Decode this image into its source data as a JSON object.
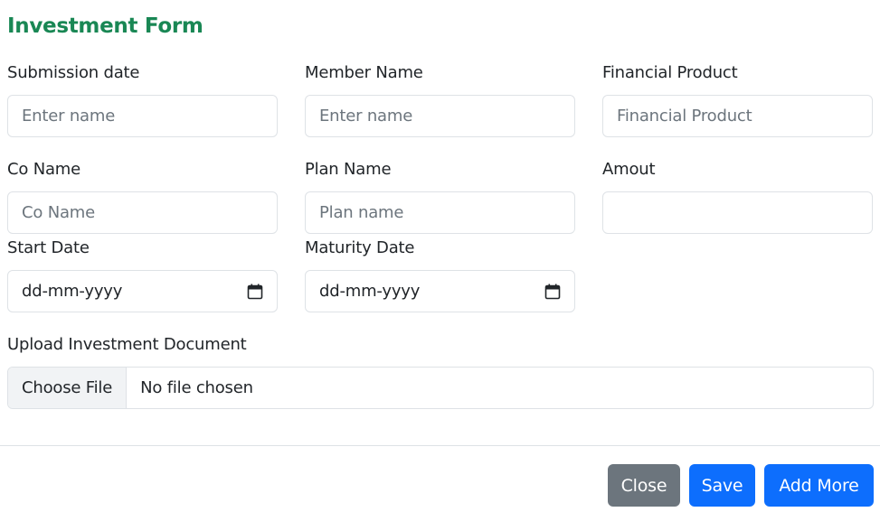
{
  "form": {
    "title": "Investment Form",
    "fields": {
      "submission_date": {
        "label": "Submission date",
        "placeholder": "Enter name",
        "value": ""
      },
      "member_name": {
        "label": "Member Name",
        "placeholder": "Enter name",
        "value": ""
      },
      "financial_product": {
        "label": "Financial Product",
        "placeholder": "Financial Product",
        "value": ""
      },
      "co_name": {
        "label": "Co Name",
        "placeholder": "Co Name",
        "value": ""
      },
      "plan_name": {
        "label": "Plan Name",
        "placeholder": "Plan name",
        "value": ""
      },
      "amount": {
        "label": "Amout",
        "placeholder": "",
        "value": ""
      },
      "start_date": {
        "label": "Start Date",
        "value": "dd-mm-yyyy",
        "icon": "calendar-icon"
      },
      "maturity_date": {
        "label": "Maturity Date",
        "value": "dd-mm-yyyy",
        "icon": "calendar-icon"
      }
    },
    "upload": {
      "label": "Upload Investment Document",
      "button_label": "Choose File",
      "status": "No file chosen"
    }
  },
  "footer": {
    "close_label": "Close",
    "save_label": "Save",
    "add_more_label": "Add More"
  },
  "colors": {
    "title": "#198754",
    "primary": "#0d6efd",
    "secondary": "#6c757d",
    "border": "#dee2e6"
  }
}
